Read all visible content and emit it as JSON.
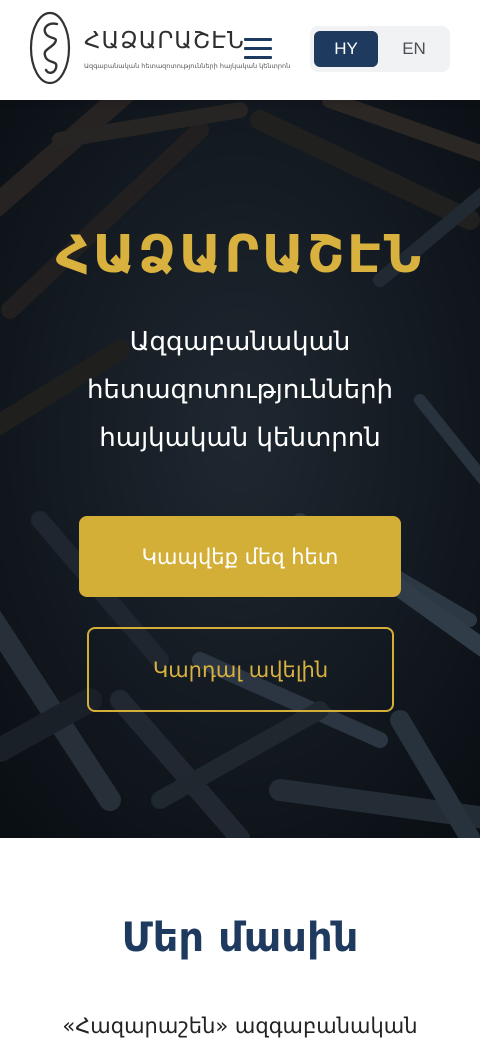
{
  "header": {
    "logo_title": "ՀԱՁԱՐԱՇԷՆ",
    "logo_subtitle": "Ազգաբանական հետազոտությունների հայկական կենտրոն",
    "lang_options": [
      "HY",
      "EN"
    ],
    "lang_selected": "HY"
  },
  "hero": {
    "title": "ՀԱՁԱՐԱՇԷՆ",
    "subtitle_lines": [
      "Ազգաբանական",
      "հետազոտությունների",
      "հայկական կենտրոն"
    ],
    "primary_button": "Կապվեք մեզ հետ",
    "secondary_button": "Կարդալ ավելին"
  },
  "about": {
    "title": "Մեր մասին",
    "text_start": "«Հազարաշեն» ազգաբանական"
  },
  "colors": {
    "accent_gold": "#d4af37",
    "navy": "#1f3a5f"
  }
}
